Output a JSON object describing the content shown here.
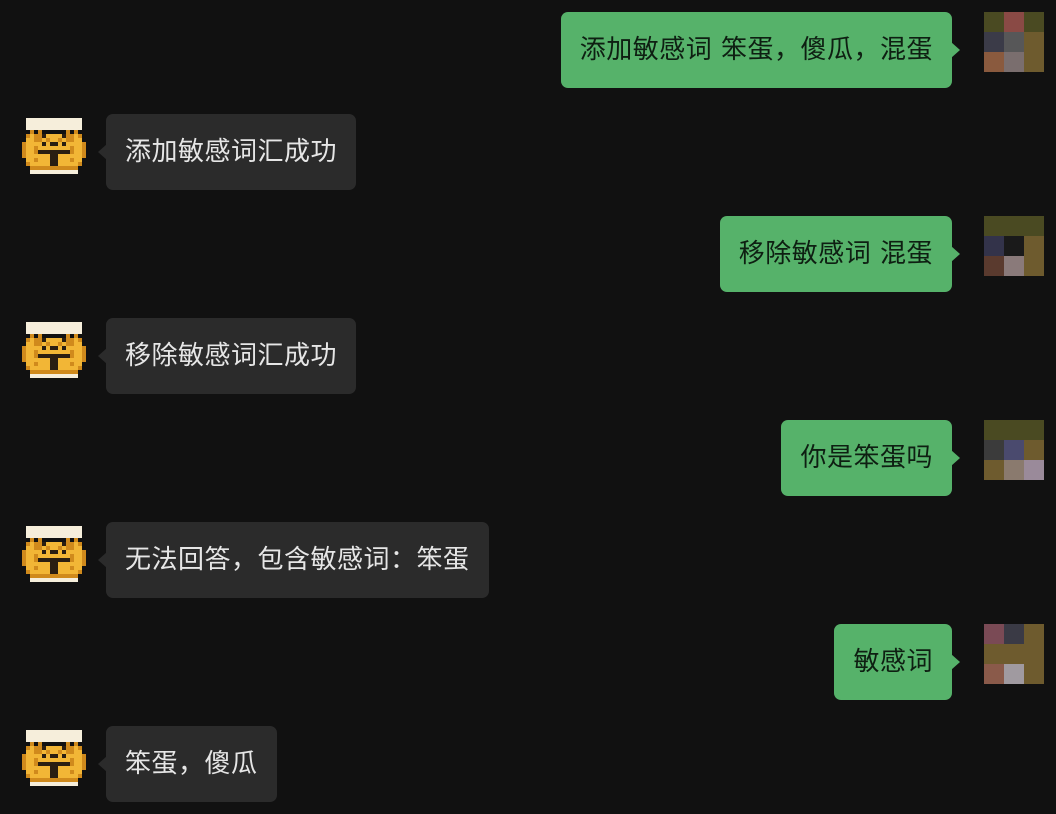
{
  "messages": [
    {
      "side": "out",
      "text": "添加敏感词 笨蛋，傻瓜，混蛋",
      "avatar_colors": [
        "#4a4a22",
        "#8a4a45",
        "#4a4a22",
        "#3b3b48",
        "#575758",
        "#6e5b2e",
        "#8a5a3e",
        "#7a6e6e",
        "#6e5b2e"
      ]
    },
    {
      "side": "in",
      "text": "添加敏感词汇成功"
    },
    {
      "side": "out",
      "text": "移除敏感词 混蛋",
      "avatar_colors": [
        "#4a4a22",
        "#4a4a22",
        "#4a4a22",
        "#33334a",
        "#1a1a1a",
        "#6e5b2e",
        "#5a3a2e",
        "#8a7a7a",
        "#6e5b2e"
      ]
    },
    {
      "side": "in",
      "text": "移除敏感词汇成功"
    },
    {
      "side": "out",
      "text": "你是笨蛋吗",
      "avatar_colors": [
        "#4a4a22",
        "#4a4a22",
        "#4a4a22",
        "#3b3b3b",
        "#4a4a6e",
        "#6e5b2e",
        "#6e5b2e",
        "#8a7a6e",
        "#9a8a9a"
      ]
    },
    {
      "side": "in",
      "text": "无法回答，包含敏感词：笨蛋"
    },
    {
      "side": "out",
      "text": "敏感词",
      "avatar_colors": [
        "#7a4a55",
        "#3a3a45",
        "#6e5b2e",
        "#6e5b2e",
        "#6e5b2e",
        "#6e5b2e",
        "#8a5a4a",
        "#a09aa0",
        "#6e5b2e"
      ]
    },
    {
      "side": "in",
      "text": "笨蛋，傻瓜"
    }
  ],
  "colors": {
    "background": "#111111",
    "outgoing_bubble": "#56b26a",
    "incoming_bubble": "#2b2b2b"
  },
  "bot_avatar": {
    "icon": "tiger-pixel-icon"
  }
}
